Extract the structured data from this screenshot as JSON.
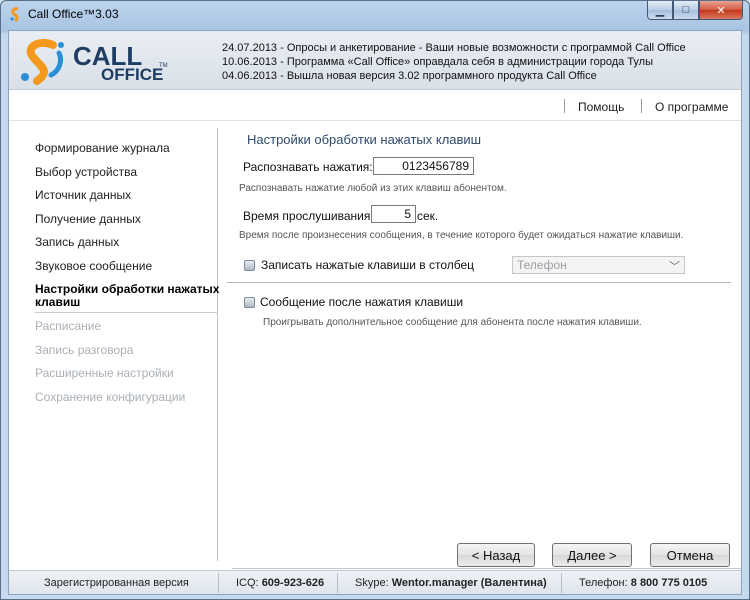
{
  "window": {
    "title": "Call Office™3.03"
  },
  "logo": {
    "line1": "CALL",
    "line2": "OFFICE",
    "tm": "TM"
  },
  "news": [
    "24.07.2013 - Опросы и анкетирование - Ваши новые возможности с программой Call Office",
    "10.06.2013 - Программа «Call Office» оправдала себя в администрации города Тулы",
    "04.06.2013 - Вышла новая версия 3.02 программного продукта Call Office"
  ],
  "topnav": {
    "help": "Помощь",
    "about": "О программе"
  },
  "sidebar": {
    "items": [
      {
        "label": "Формирование журнала"
      },
      {
        "label": "Выбор устройства"
      },
      {
        "label": "Источник данных"
      },
      {
        "label": "Получение данных"
      },
      {
        "label": "Запись данных"
      },
      {
        "label": "Звуковое сообщение"
      },
      {
        "label": "Настройки обработки нажатых клавиш"
      },
      {
        "label": "Расписание"
      },
      {
        "label": "Запись разговора"
      },
      {
        "label": "Расширенные настройки"
      },
      {
        "label": "Сохранение конфигурации"
      }
    ]
  },
  "main": {
    "title": "Настройки обработки нажатых клавиш",
    "recognize_label": "Распознавать нажатия:",
    "recognize_value": "0123456789",
    "recognize_hint": "Распознавать нажатие любой из этих клавиш абонентом.",
    "listen_label": "Время прослушивания:",
    "listen_value": "5",
    "listen_unit": "сек.",
    "listen_hint": "Время после произнесения сообщения, в течение которого будет ожидаться нажатие клавиши.",
    "write_column_label": "Записать нажатые клавиши в столбец",
    "write_column_value": "Телефон",
    "message_after_label": "Сообщение после нажатия клавиши",
    "message_after_hint": "Проигрывать дополнительное сообщение для абонента после нажатия клавиши."
  },
  "buttons": {
    "back": "< Назад",
    "next": "Далее >",
    "cancel": "Отмена"
  },
  "status": {
    "registered": "Зарегистрированная версия",
    "icq_label": "ICQ:",
    "icq_value": "609-923-626",
    "skype_label": "Skype:",
    "skype_value": "Wentor.manager (Валентина)",
    "phone_label": "Телефон:",
    "phone_value": "8 800 775 0105"
  },
  "colors": {
    "accent": "#2f4a6a",
    "logo_orange": "#f39a1e",
    "logo_blue": "#2b8fd6"
  }
}
